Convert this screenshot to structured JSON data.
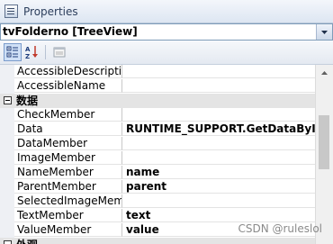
{
  "window": {
    "title": "Properties"
  },
  "object_selector": {
    "value": "tvFolderno [TreeView]"
  },
  "toolbar": {
    "categorized_tooltip": "Categorized",
    "alphabetical_tooltip": "Alphabetical",
    "property_pages_tooltip": "Property Pages"
  },
  "grid": {
    "rows": [
      {
        "type": "prop",
        "name": "AccessibleDescription",
        "value": ""
      },
      {
        "type": "prop",
        "name": "AccessibleName",
        "value": ""
      },
      {
        "type": "cat",
        "label": "数据"
      },
      {
        "type": "prop",
        "name": "CheckMember",
        "value": ""
      },
      {
        "type": "prop",
        "name": "Data",
        "value": "RUNTIME_SUPPORT.GetDataById.li"
      },
      {
        "type": "prop",
        "name": "DataMember",
        "value": ""
      },
      {
        "type": "prop",
        "name": "ImageMember",
        "value": ""
      },
      {
        "type": "prop",
        "name": "NameMember",
        "value": "name"
      },
      {
        "type": "prop",
        "name": "ParentMember",
        "value": "parent"
      },
      {
        "type": "prop",
        "name": "SelectedImageMember",
        "value": ""
      },
      {
        "type": "prop",
        "name": "TextMember",
        "value": "text"
      },
      {
        "type": "prop",
        "name": "ValueMember",
        "value": "value"
      },
      {
        "type": "cat",
        "label": "外观"
      }
    ]
  },
  "watermark": "CSDN @ruleslol"
}
